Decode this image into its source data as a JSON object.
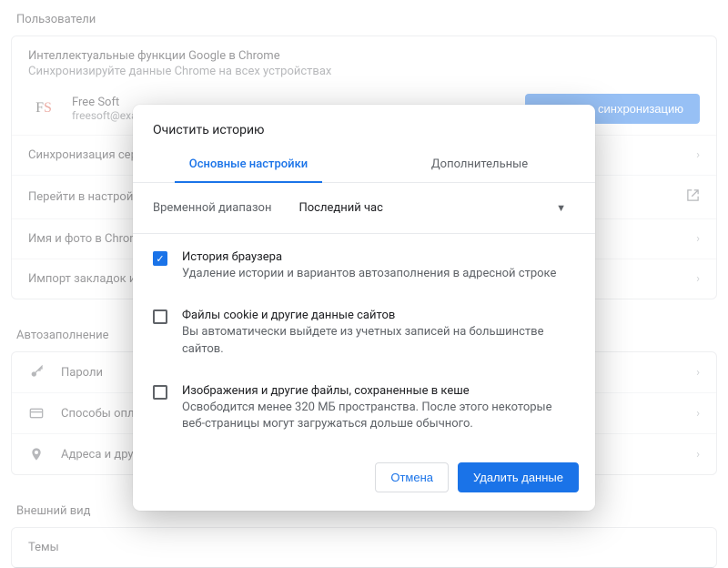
{
  "sections": {
    "users_title": "Пользователи",
    "autofill_title": "Автозаполнение",
    "appearance_title": "Внешний вид"
  },
  "usersCard": {
    "heading": "Интеллектуальные функции Google в Chrome",
    "sub": "Синхронизируйте данные Chrome на всех устройствах",
    "user_name": "Free Soft",
    "user_email": "freesoft@example",
    "sync_button": "Включить синхронизацию",
    "rows": {
      "sync": "Синхронизация сервисов Google",
      "google": "Перейти в настройки Google",
      "name": "Имя и фото в Chrome",
      "import": "Импорт закладок и настроек"
    }
  },
  "autofill": {
    "passwords": "Пароли",
    "payments": "Способы оплаты",
    "addresses": "Адреса и другие данные"
  },
  "dialog": {
    "title": "Очистить историю",
    "tabs": {
      "basic": "Основные настройки",
      "advanced": "Дополнительные"
    },
    "range_label": "Временной диапазон",
    "range_value": "Последний час",
    "items": [
      {
        "checked": true,
        "title": "История браузера",
        "desc": "Удаление истории и вариантов автозаполнения в адресной строке"
      },
      {
        "checked": false,
        "title": "Файлы cookie и другие данные сайтов",
        "desc": "Вы автоматически выйдете из учетных записей на большинстве сайтов."
      },
      {
        "checked": false,
        "title": "Изображения и другие файлы, сохраненные в кеше",
        "desc": "Освободится менее 320 МБ пространства. После этого некоторые веб-страницы могут загружаться дольше обычного."
      }
    ],
    "cancel": "Отмена",
    "confirm": "Удалить данные"
  },
  "themes_row": "Темы"
}
